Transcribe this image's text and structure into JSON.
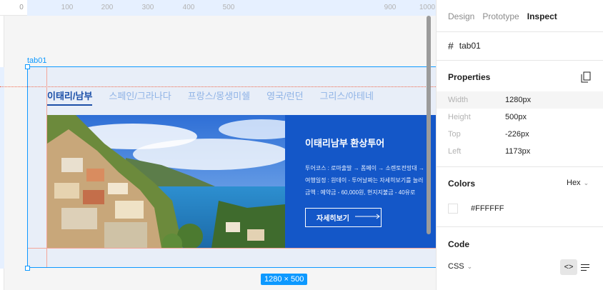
{
  "ruler": {
    "ticks": [
      "0",
      "100",
      "200",
      "300",
      "400",
      "500",
      "900",
      "1000"
    ]
  },
  "canvas": {
    "frame_label": "tab01",
    "size_badge": "1280 × 500",
    "tabs": [
      {
        "label": "이태리/남부",
        "active": true
      },
      {
        "label": "스페인/그라나다",
        "active": false
      },
      {
        "label": "프랑스/몽생미쉘",
        "active": false
      },
      {
        "label": "영국/런던",
        "active": false
      },
      {
        "label": "그리스/아테네",
        "active": false
      }
    ],
    "banner": {
      "title": "이태리남부 환상투어",
      "lines": [
        "투어코스 : 로마출발 → 폼페이 → 소렌토전망대 →",
        "여행일정 : 원데이 - 투어날짜는 자세히보기를 눌러",
        "금액 : 예약금 - 60,000원, 현지지불금 - 40유로"
      ],
      "button_label": "자세히보기",
      "panel_color": "#1457C8"
    }
  },
  "inspector": {
    "tabs": [
      {
        "label": "Design",
        "active": false
      },
      {
        "label": "Prototype",
        "active": false
      },
      {
        "label": "Inspect",
        "active": true
      }
    ],
    "layer_name": "tab01",
    "properties_title": "Properties",
    "properties": [
      {
        "key": "Width",
        "value": "1280px"
      },
      {
        "key": "Height",
        "value": "500px"
      },
      {
        "key": "Top",
        "value": "-226px"
      },
      {
        "key": "Left",
        "value": "1173px"
      }
    ],
    "colors_title": "Colors",
    "color_format": "Hex",
    "color_value": "#FFFFFF",
    "code_title": "Code",
    "code_lang": "CSS"
  },
  "colors": {
    "accent": "#0D99FF",
    "guide": "#F24822",
    "tab_active": "#1B4FA8"
  }
}
